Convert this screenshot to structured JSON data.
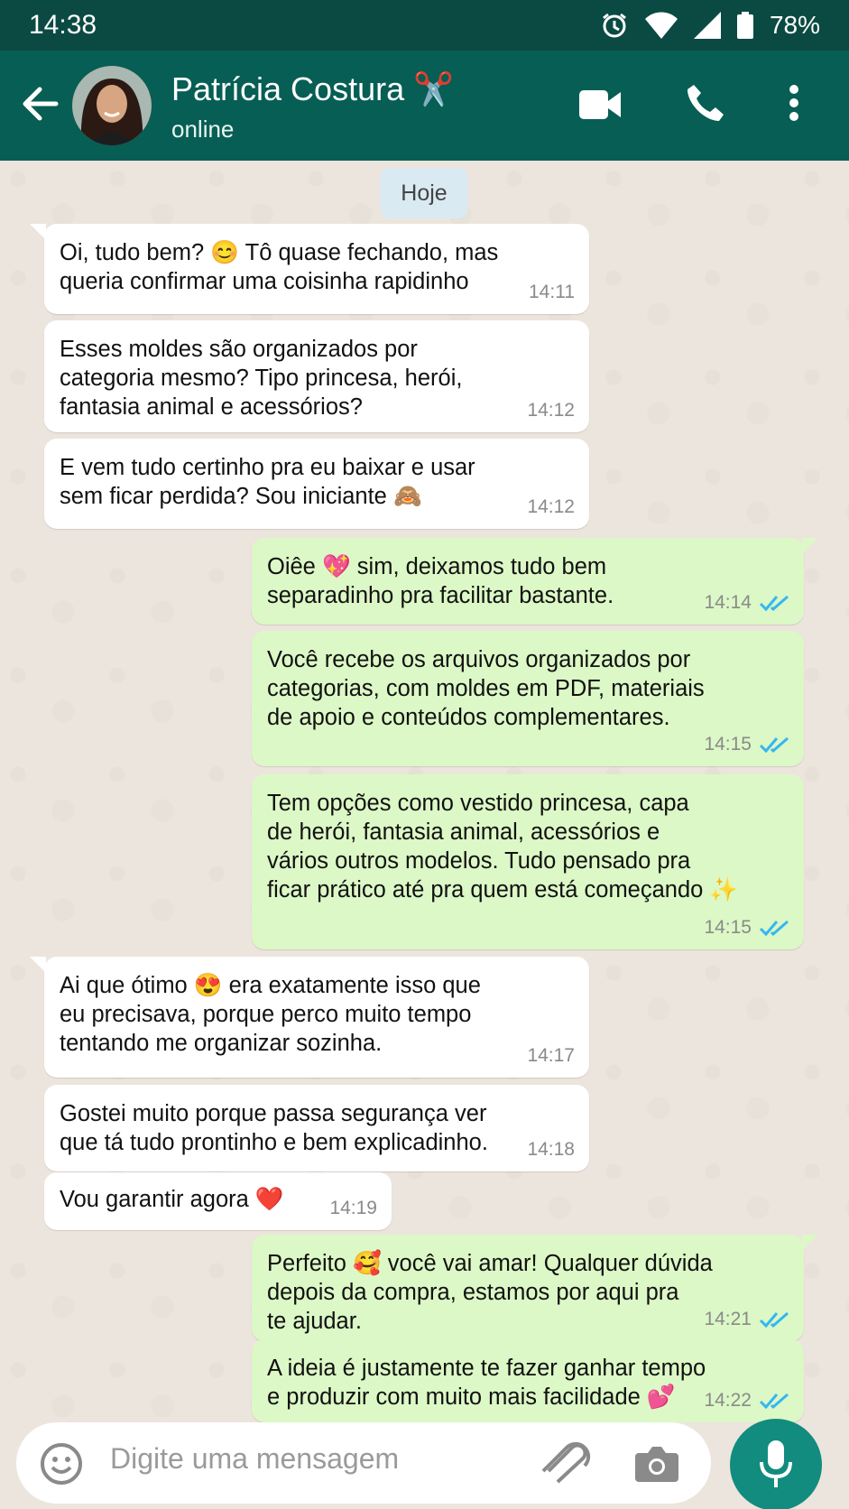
{
  "status_bar": {
    "time": "14:38",
    "battery": "78%"
  },
  "header": {
    "contact_name": "Patrícia Costura ✂️",
    "contact_status": "online",
    "icons": [
      "back-arrow-icon",
      "avatar",
      "video-call-icon",
      "phone-icon",
      "more-options-icon"
    ]
  },
  "chat": {
    "date_chip": "Hoje",
    "messages": [
      {
        "dir": "in",
        "text": "Oi, tudo bem? 😊 Tô quase fechando, mas\nqueria confirmar uma coisinha rapidinho",
        "time": "14:11"
      },
      {
        "dir": "in",
        "text": "Esses moldes são organizados por\ncategoria mesmo? Tipo princesa, herói,\nfantasia animal e acessórios?",
        "time": "14:12"
      },
      {
        "dir": "in",
        "text": "E vem tudo certinho pra eu baixar e usar\nsem ficar perdida? Sou iniciante 🙈",
        "time": "14:12"
      },
      {
        "dir": "out",
        "text": "Oiêe 💖 sim, deixamos tudo bem\nseparadinho pra facilitar bastante.",
        "time": "14:14"
      },
      {
        "dir": "out",
        "text": "Você recebe os arquivos organizados por\ncategorias, com moldes em PDF, materiais\nde apoio e conteúdos complementares.",
        "time": "14:15"
      },
      {
        "dir": "out",
        "text": "Tem opções como vestido princesa, capa\nde herói, fantasia animal, acessórios e\nvários outros modelos. Tudo pensado pra\nficar prático até pra quem está começando ✨",
        "time": "14:15"
      },
      {
        "dir": "in",
        "text": "Ai que ótimo 😍 era exatamente isso que\neu precisava, porque perco muito tempo\ntentando me organizar sozinha.",
        "time": "14:17"
      },
      {
        "dir": "in",
        "text": "Gostei muito porque passa segurança ver\nque tá tudo prontinho e bem explicadinho.",
        "time": "14:18"
      },
      {
        "dir": "in",
        "text": "Vou garantir agora ❤️",
        "time": "14:19"
      },
      {
        "dir": "out",
        "text": "Perfeito 🥰 você vai amar! Qualquer dúvida\ndepois da compra, estamos por aqui pra\nte ajudar.",
        "time": "14:21"
      },
      {
        "dir": "out",
        "text": "A ideia é justamente te fazer ganhar tempo\ne produzir com muito mais facilidade 💕",
        "time": "14:22"
      }
    ]
  },
  "input": {
    "placeholder": "Digite uma mensagem"
  },
  "colors": {
    "header": "#075e54",
    "status_bar": "#0b4a43",
    "outgoing": "#dcf8c6",
    "incoming": "#ffffff",
    "read_ticks": "#34b7f1",
    "mic": "#128c7e"
  }
}
